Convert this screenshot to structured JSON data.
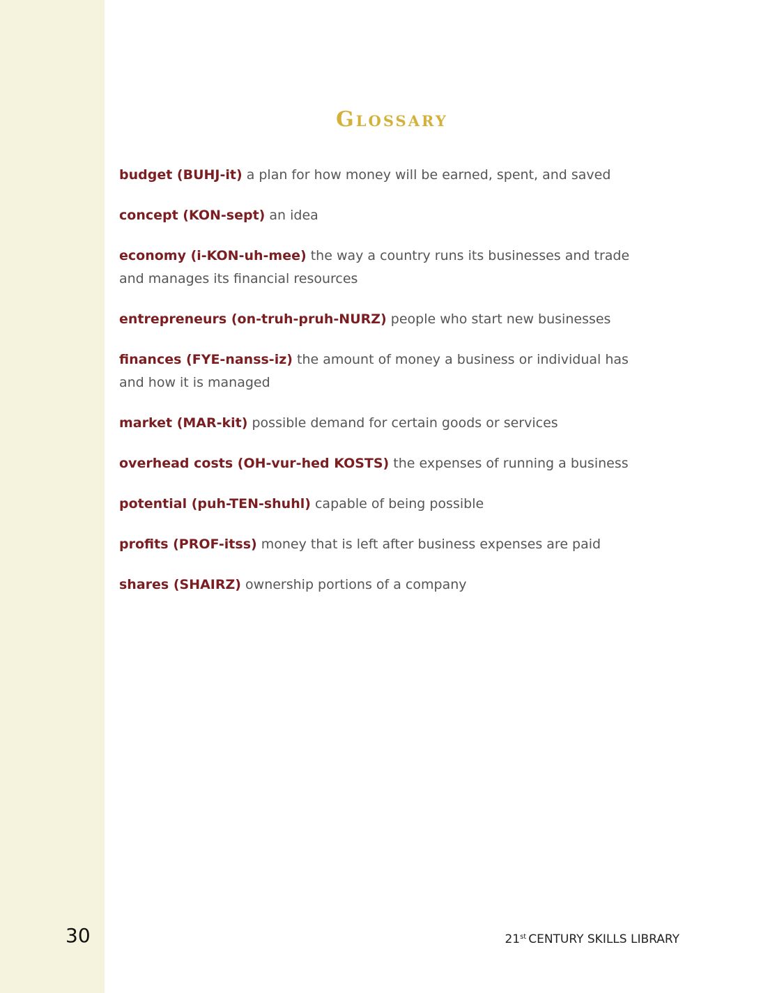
{
  "page": {
    "title": "Glossary",
    "page_number": "30",
    "footer": {
      "number": "21",
      "suffix": "st",
      "text": "CENTURY SKILLS LIBRARY"
    }
  },
  "colors": {
    "sidebar": "#f5f2de",
    "title": "#d4b13a",
    "term": "#7a1e22",
    "definition": "#555555"
  },
  "entries": [
    {
      "term": "budget (BUHJ-it)",
      "definition": "a plan for how money will be earned, spent, and saved"
    },
    {
      "term": "concept (KON-sept)",
      "definition": "an idea"
    },
    {
      "term": "economy (i-KON-uh-mee)",
      "definition": "the way a country runs its businesses and trade and manages its financial resources"
    },
    {
      "term": "entrepreneurs (on-truh-pruh-NURZ)",
      "definition": "people who start new businesses"
    },
    {
      "term": "finances (FYE-nanss-iz)",
      "definition": "the amount of money a business or individual has and how it is managed"
    },
    {
      "term": "market (MAR-kit)",
      "definition": "possible demand for certain goods or services"
    },
    {
      "term": "overhead costs (OH-vur-hed KOSTS)",
      "definition": "the expenses of running a business"
    },
    {
      "term": "potential (puh-TEN-shuhl)",
      "definition": "capable of being possible"
    },
    {
      "term": "profits (PROF-itss)",
      "definition": "money that is left after business expenses are paid"
    },
    {
      "term": "shares (SHAIRZ)",
      "definition": "ownership portions of a company"
    }
  ]
}
